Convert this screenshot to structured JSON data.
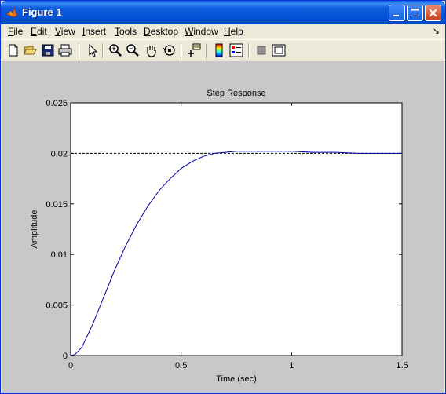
{
  "window": {
    "title": "Figure 1",
    "icon": "matlab-logo-icon",
    "controls": [
      "minimize-icon",
      "maximize-icon",
      "close-icon"
    ]
  },
  "menu": {
    "items": [
      {
        "pre": "",
        "u": "F",
        "post": "ile"
      },
      {
        "pre": "",
        "u": "E",
        "post": "dit"
      },
      {
        "pre": "",
        "u": "V",
        "post": "iew"
      },
      {
        "pre": "",
        "u": "I",
        "post": "nsert"
      },
      {
        "pre": "",
        "u": "T",
        "post": "ools"
      },
      {
        "pre": "",
        "u": "D",
        "post": "esktop"
      },
      {
        "pre": "",
        "u": "W",
        "post": "indow"
      },
      {
        "pre": "",
        "u": "H",
        "post": "elp"
      }
    ],
    "dock_arrow": "↘"
  },
  "toolbar": {
    "tools": [
      "new-file-icon",
      "open-folder-icon",
      "save-icon",
      "print-icon",
      "pointer-icon",
      "zoom-in-icon",
      "zoom-out-icon",
      "pan-hand-icon",
      "rotate-3d-icon",
      "data-cursor-icon",
      "colorbar-icon",
      "legend-icon",
      "hide-plot-tools-icon",
      "show-plot-tools-icon"
    ]
  },
  "chart_data": {
    "type": "line",
    "title": "Step Response",
    "xlabel": "Time (sec)",
    "ylabel": "Amplitude",
    "xlim": [
      0,
      1.5
    ],
    "ylim": [
      0,
      0.025
    ],
    "xticks": [
      "0",
      "0.5",
      "1",
      "1.5"
    ],
    "yticks": [
      "0",
      "0.005",
      "0.01",
      "0.015",
      "0.02",
      "0.025"
    ],
    "grid": false,
    "series": [
      {
        "color": "#0000a0",
        "x": [
          0,
          0.02,
          0.05,
          0.1,
          0.15,
          0.2,
          0.25,
          0.3,
          0.35,
          0.4,
          0.45,
          0.5,
          0.55,
          0.6,
          0.65,
          0.7,
          0.75,
          0.8,
          0.9,
          1.0,
          1.1,
          1.2,
          1.3,
          1.4,
          1.5
        ],
        "y": [
          0,
          0.0001,
          0.0008,
          0.0031,
          0.0058,
          0.0085,
          0.0109,
          0.013,
          0.0148,
          0.0163,
          0.0175,
          0.0185,
          0.0192,
          0.0197,
          0.02,
          0.0201,
          0.0202,
          0.0202,
          0.0202,
          0.0202,
          0.0201,
          0.0201,
          0.02,
          0.02,
          0.02
        ]
      }
    ],
    "reference_line": {
      "y": 0.02,
      "style": "dashed",
      "color": "#000000"
    }
  }
}
